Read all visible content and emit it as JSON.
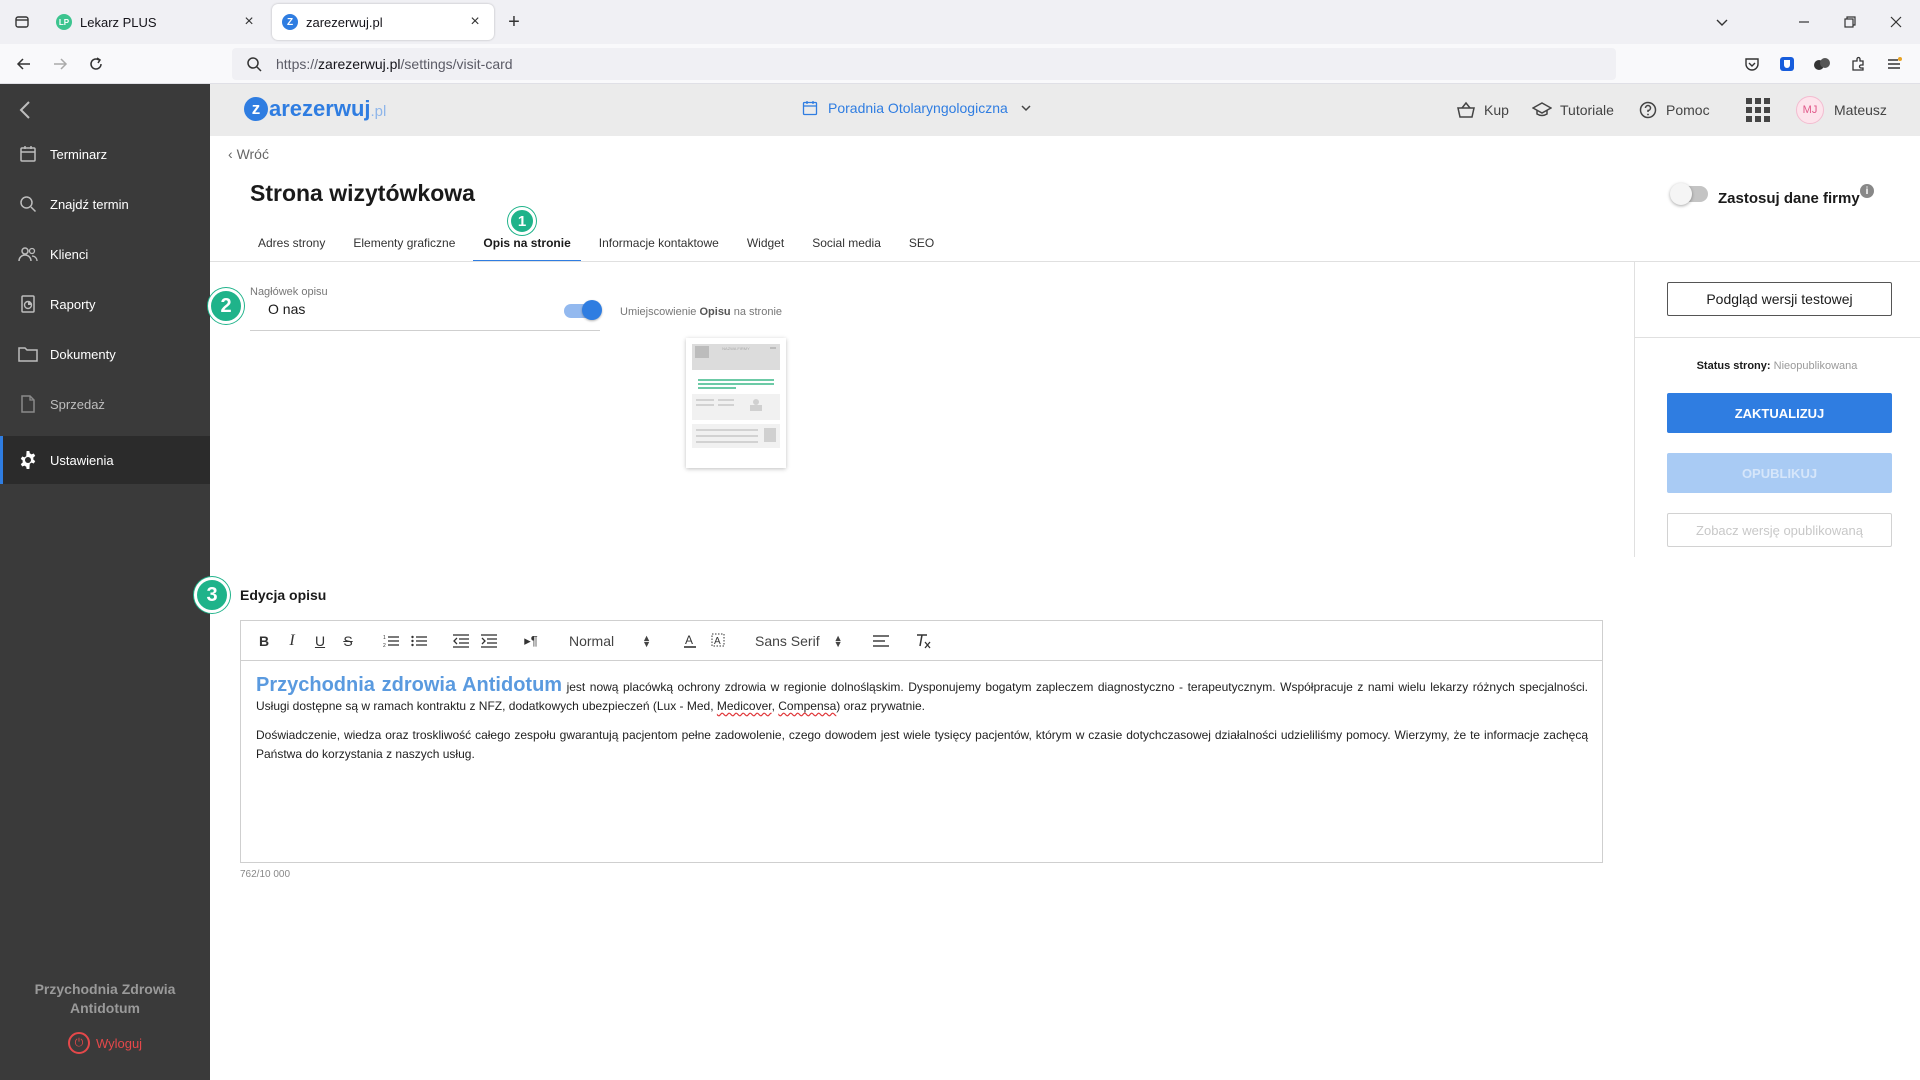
{
  "browser": {
    "tabs": [
      {
        "title": "Lekarz PLUS",
        "favicon": "LP"
      },
      {
        "title": "zarezerwuj.pl",
        "favicon": "Z"
      }
    ],
    "url_scheme": "https://",
    "url_host": "zarezerwuj.pl",
    "url_path": "/settings/visit-card"
  },
  "header": {
    "logo_main": "arezerwuj",
    "logo_letter": "z",
    "logo_tld": ".pl",
    "clinic": "Poradnia Otolaryngologiczna",
    "links": {
      "buy": "Kup",
      "tutorials": "Tutoriale",
      "help": "Pomoc"
    },
    "avatar_initials": "MJ",
    "username": "Mateusz"
  },
  "sidebar": {
    "items": [
      {
        "label": "Terminarz",
        "icon": "calendar-icon"
      },
      {
        "label": "Znajdź termin",
        "icon": "search-icon"
      },
      {
        "label": "Klienci",
        "icon": "users-icon"
      },
      {
        "label": "Raporty",
        "icon": "report-icon"
      },
      {
        "label": "Dokumenty",
        "icon": "folder-icon"
      },
      {
        "label": "Sprzedaż",
        "icon": "document-icon"
      },
      {
        "label": "Ustawienia",
        "icon": "gear-icon"
      }
    ],
    "company_line1": "Przychodnia Zdrowia",
    "company_line2": "Antidotum",
    "logout": "Wyloguj"
  },
  "main": {
    "back": "Wróć",
    "title": "Strona wizytówkowa",
    "company_toggle_label": "Zastosuj dane firmy",
    "company_toggle_on": false,
    "tabs": [
      "Adres strony",
      "Elementy graficzne",
      "Opis na stronie",
      "Informacje kontaktowe",
      "Widget",
      "Social media",
      "SEO"
    ],
    "active_tab": "Opis na stronie",
    "steps": [
      "1",
      "2",
      "3"
    ],
    "field_label": "Nagłówek opisu",
    "field_value": "O nas",
    "header_toggle_on": true,
    "placement_prefix": "Umiejscowienie ",
    "placement_bold": "Opisu",
    "placement_suffix": " na stronie",
    "thumb_label": "NAZWA FIRMY"
  },
  "right_panel": {
    "preview_button": "Podgląd wersji testowej",
    "status_label": "Status strony:",
    "status_value": "Nieopublikowana",
    "update_button": "ZAKTUALIZUJ",
    "publish_button": "OPUBLIKUJ",
    "view_published_button": "Zobacz wersję opublikowaną"
  },
  "editor": {
    "section_title": "Edycja opisu",
    "format_select": "Normal",
    "font_select": "Sans Serif",
    "lead": "Przychodnia zdrowia Antidotum",
    "p1_a": " jest nową placówką ochrony zdrowia w regionie dolnośląskim. Dysponujemy bogatym zapleczem diagnostyczno - terapeutycznym. Współpracuje z nami wielu lekarzy różnych specjalności. Usługi dostępne są w ramach kontraktu z NFZ, dodatkowych ubezpieczeń (Lux - Med, ",
    "p1_sp1": "Medicover",
    "p1_b": ", ",
    "p1_sp2": "Compensa",
    "p1_c": ") oraz prywatnie.",
    "p2": "Doświadczenie, wiedza oraz troskliwość całego zespołu gwarantują pacjentom pełne zadowolenie, czego dowodem jest wiele tysięcy pacjentów, którym w czasie dotychczasowej działalności udzieliliśmy pomocy. Wierzymy, że te informacje zachęcą Państwa do korzystania z naszych usług.",
    "char_count": "762/10 000"
  },
  "colors": {
    "accent": "#2f7de1",
    "step_badge": "#1fb38a",
    "sidebar": "#3a3a3a",
    "logout": "#e4484a"
  }
}
